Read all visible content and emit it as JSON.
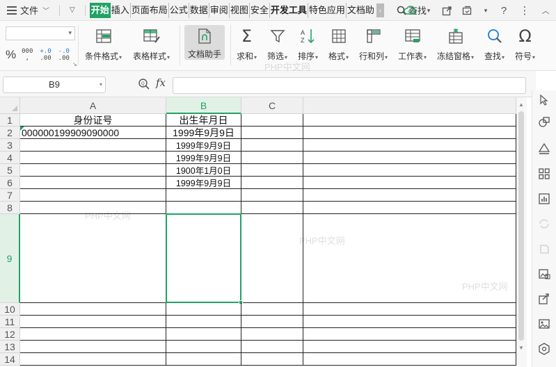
{
  "menubar": {
    "file_label": "文件",
    "tabs": [
      {
        "label": "开始",
        "active": true
      },
      {
        "label": "插入"
      },
      {
        "label": "页面布局"
      },
      {
        "label": "公式"
      },
      {
        "label": "数据"
      },
      {
        "label": "审阅"
      },
      {
        "label": "视图"
      },
      {
        "label": "安全"
      },
      {
        "label": "开发工具",
        "bold": true
      },
      {
        "label": "特色应用"
      },
      {
        "label": "文档助"
      }
    ],
    "search_label": "查找"
  },
  "ribbon": {
    "percent": "%",
    "thousands": "000",
    "inc_decimal_top": "+.0",
    "inc_decimal_bottom": ".00",
    "dec_decimal_top": "-.0",
    "dec_decimal_bottom": ".00",
    "buttons": {
      "conditional_format": "条件格式",
      "table_style": "表格样式",
      "doc_helper": "文档助手",
      "sum": "求和",
      "filter": "筛选",
      "sort": "排序",
      "format": "格式",
      "row_col": "行和列",
      "worksheet": "工作表",
      "freeze": "冻结窗格",
      "find": "查找",
      "symbol": "符号"
    }
  },
  "formula_bar": {
    "name_box": "B9",
    "fx": "fx",
    "formula": ""
  },
  "sheet": {
    "columns": [
      "A",
      "B",
      "C"
    ],
    "selected_column": "B",
    "selected_row": "9",
    "rows": [
      {
        "num": "1",
        "a": "身份证号",
        "b": "出生年月日"
      },
      {
        "num": "2",
        "a": "000000199909090000",
        "b": "1999年9月9日"
      },
      {
        "num": "3",
        "a": "",
        "b": "1999年9月9日"
      },
      {
        "num": "4",
        "a": "",
        "b": "1999年9月9日"
      },
      {
        "num": "5",
        "a": "",
        "b": "1900年1月0日"
      },
      {
        "num": "6",
        "a": "",
        "b": "1999年9月9日"
      },
      {
        "num": "7",
        "a": "",
        "b": ""
      },
      {
        "num": "8",
        "a": "",
        "b": ""
      },
      {
        "num": "9",
        "a": "",
        "b": ""
      },
      {
        "num": "10",
        "a": "",
        "b": ""
      },
      {
        "num": "11",
        "a": "",
        "b": ""
      },
      {
        "num": "12",
        "a": "",
        "b": ""
      },
      {
        "num": "13",
        "a": "",
        "b": ""
      },
      {
        "num": "14",
        "a": "",
        "b": ""
      }
    ]
  },
  "watermark": "PHP中文网"
}
